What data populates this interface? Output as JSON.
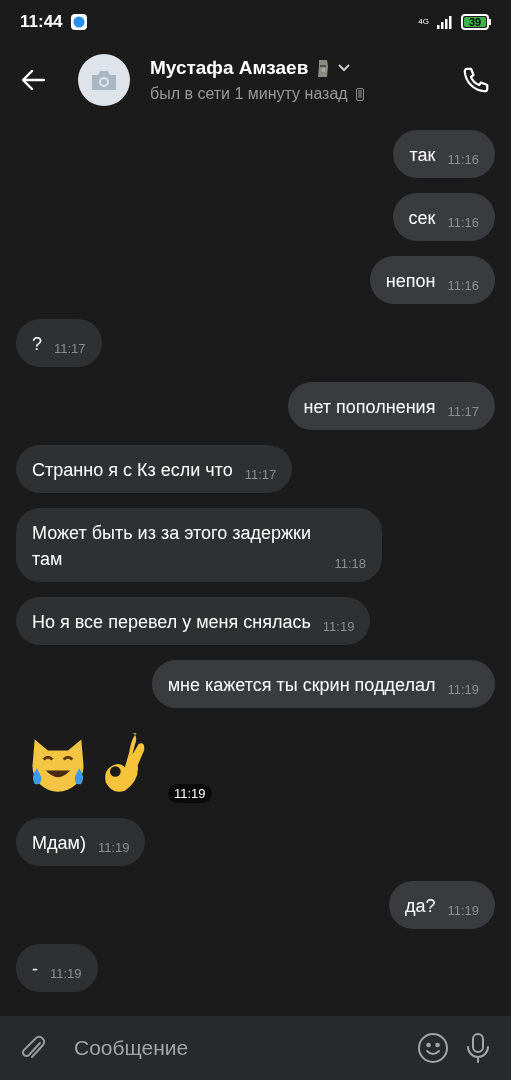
{
  "status_bar": {
    "time": "11:44",
    "network": "4G",
    "battery": "39"
  },
  "header": {
    "name": "Мустафа Амзаев",
    "status": "был в сети 1 минуту назад"
  },
  "messages": [
    {
      "kind": "text",
      "outgoing": true,
      "text": "так",
      "time": "11:16"
    },
    {
      "kind": "text",
      "outgoing": true,
      "text": "сек",
      "time": "11:16"
    },
    {
      "kind": "text",
      "outgoing": true,
      "text": "непон",
      "time": "11:16"
    },
    {
      "kind": "text",
      "outgoing": false,
      "text": "?",
      "time": "11:17"
    },
    {
      "kind": "text",
      "outgoing": true,
      "text": "нет пополнения",
      "time": "11:17"
    },
    {
      "kind": "text",
      "outgoing": false,
      "text": "Странно я с Кз если что",
      "time": "11:17"
    },
    {
      "kind": "text",
      "outgoing": false,
      "text": "Может быть из за этого задержки там",
      "time": "11:18"
    },
    {
      "kind": "text",
      "outgoing": false,
      "text": "Но я все перевел у меня снялась",
      "time": "11:19"
    },
    {
      "kind": "text",
      "outgoing": true,
      "text": "мне кажется ты скрин подделал",
      "time": "11:19"
    },
    {
      "kind": "emoji",
      "outgoing": false,
      "time": "11:19"
    },
    {
      "kind": "text",
      "outgoing": false,
      "text": "Мдам)",
      "time": "11:19"
    },
    {
      "kind": "text",
      "outgoing": true,
      "text": "да?",
      "time": "11:19"
    },
    {
      "kind": "text",
      "outgoing": false,
      "text": "-",
      "time": "11:19"
    }
  ],
  "composer": {
    "placeholder": "Сообщение"
  }
}
